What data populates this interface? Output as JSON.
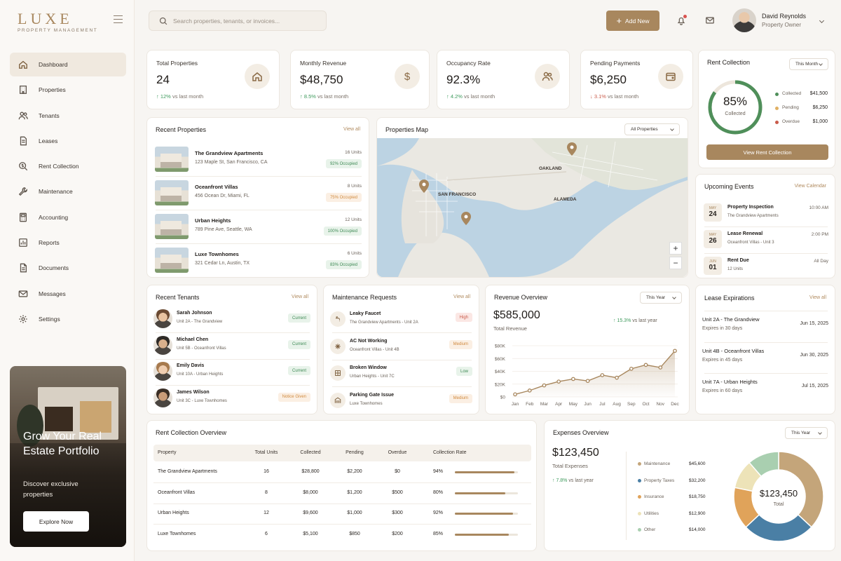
{
  "brand": {
    "name": "LUXE",
    "subtitle": "PROPERTY MANAGEMENT"
  },
  "nav": [
    {
      "label": "Dashboard",
      "icon": "home-icon",
      "active": true
    },
    {
      "label": "Properties",
      "icon": "building-icon"
    },
    {
      "label": "Tenants",
      "icon": "users-icon"
    },
    {
      "label": "Leases",
      "icon": "document-icon"
    },
    {
      "label": "Rent Collection",
      "icon": "dollar-search-icon"
    },
    {
      "label": "Maintenance",
      "icon": "wrench-icon"
    },
    {
      "label": "Accounting",
      "icon": "calculator-icon"
    },
    {
      "label": "Reports",
      "icon": "chart-icon"
    },
    {
      "label": "Documents",
      "icon": "file-icon"
    },
    {
      "label": "Messages",
      "icon": "mail-icon"
    },
    {
      "label": "Settings",
      "icon": "gear-icon"
    }
  ],
  "promo": {
    "title": "Grow Your Real Estate Portfolio",
    "subtitle": "Discover exclusive properties",
    "button": "Explore Now"
  },
  "header": {
    "search_placeholder": "Search properties, tenants, or invoices...",
    "add_button": "Add New",
    "user_name": "David Reynolds",
    "user_role": "Property Owner"
  },
  "stats": [
    {
      "label": "Total Properties",
      "value": "24",
      "change": "12%",
      "direction": "up",
      "suffix": "vs last month",
      "icon": "home-icon"
    },
    {
      "label": "Monthly Revenue",
      "value": "$48,750",
      "change": "8.5%",
      "direction": "up",
      "suffix": "vs last month",
      "icon": "dollar-icon"
    },
    {
      "label": "Occupancy Rate",
      "value": "92.3%",
      "change": "4.2%",
      "direction": "up",
      "suffix": "vs last month",
      "icon": "users-icon"
    },
    {
      "label": "Pending Payments",
      "value": "$6,250",
      "change": "3.1%",
      "direction": "down",
      "suffix": "vs last month",
      "icon": "wallet-icon"
    }
  ],
  "rent_collection": {
    "title": "Rent Collection",
    "period": "This Month",
    "percent": "85%",
    "percent_value": 0.85,
    "percent_label": "Collected",
    "items": [
      {
        "label": "Collected",
        "value": "$41,500",
        "color": "#4f8f5a"
      },
      {
        "label": "Pending",
        "value": "$6,250",
        "color": "#e0b063"
      },
      {
        "label": "Overdue",
        "value": "$1,000",
        "color": "#c95b4a"
      }
    ],
    "button": "View Rent Collection"
  },
  "recent_properties": {
    "title": "Recent Properties",
    "link": "View all",
    "items": [
      {
        "name": "The Grandview Apartments",
        "address": "123 Maple St, San Francisco, CA",
        "units": "16 Units",
        "occupancy": "92% Occupied",
        "status": "green"
      },
      {
        "name": "Oceanfront Villas",
        "address": "456 Ocean Dr, Miami, FL",
        "units": "8 Units",
        "occupancy": "75% Occupied",
        "status": "orange"
      },
      {
        "name": "Urban Heights",
        "address": "789 Pine Ave, Seattle, WA",
        "units": "12 Units",
        "occupancy": "100% Occupied",
        "status": "green"
      },
      {
        "name": "Luxe Townhomes",
        "address": "321 Cedar Ln, Austin, TX",
        "units": "6 Units",
        "occupancy": "83% Occupied",
        "status": "green"
      }
    ]
  },
  "map": {
    "title": "Properties Map",
    "filter": "All Properties",
    "labels": [
      "SAN FRANCISCO",
      "OAKLAND",
      "ALAMEDA"
    ],
    "zoom_in": "+",
    "zoom_out": "−"
  },
  "events": {
    "title": "Upcoming Events",
    "link": "View Calendar",
    "items": [
      {
        "month": "MAY",
        "day": "24",
        "title": "Property Inspection",
        "sub": "The Grandview Apartments",
        "time": "10:00 AM"
      },
      {
        "month": "MAY",
        "day": "26",
        "title": "Lease Renewal",
        "sub": "Oceanfront Villas - Unit 3",
        "time": "2:00 PM"
      },
      {
        "month": "JUN",
        "day": "01",
        "title": "Rent Due",
        "sub": "12 Units",
        "time": "All Day"
      }
    ]
  },
  "tenants": {
    "title": "Recent Tenants",
    "link": "View all",
    "items": [
      {
        "name": "Sarah Johnson",
        "unit": "Unit 2A - The Grandview",
        "status": "Current",
        "color": "green"
      },
      {
        "name": "Michael Chen",
        "unit": "Unit 5B - Oceanfront Villas",
        "status": "Current",
        "color": "green"
      },
      {
        "name": "Emily Davis",
        "unit": "Unit 10A - Urban Heights",
        "status": "Current",
        "color": "green"
      },
      {
        "name": "James Wilson",
        "unit": "Unit 3C - Luxe Townhomes",
        "status": "Notice Given",
        "color": "orange"
      }
    ]
  },
  "maintenance": {
    "title": "Maintenance Requests",
    "link": "View all",
    "items": [
      {
        "title": "Leaky Faucet",
        "sub": "The Grandview Apartments - Unit 2A",
        "priority": "High",
        "color": "red",
        "icon": "faucet-icon"
      },
      {
        "title": "AC Not Working",
        "sub": "Oceanfront Villas - Unit 4B",
        "priority": "Medium",
        "color": "orange",
        "icon": "ac-icon"
      },
      {
        "title": "Broken Window",
        "sub": "Urban Heights - Unit 7C",
        "priority": "Low",
        "color": "green",
        "icon": "window-icon"
      },
      {
        "title": "Parking Gate Issue",
        "sub": "Luxe Townhomes",
        "priority": "Medium",
        "color": "orange",
        "icon": "gate-icon"
      }
    ]
  },
  "revenue": {
    "title": "Revenue Overview",
    "period": "This Year",
    "total": "$585,000",
    "total_label": "Total Revenue",
    "change": "15.3%",
    "change_suffix": "vs last year"
  },
  "chart_data": {
    "type": "area",
    "categories": [
      "Jan",
      "Feb",
      "Mar",
      "Apr",
      "May",
      "Jun",
      "Jul",
      "Aug",
      "Sep",
      "Oct",
      "Nov",
      "Dec"
    ],
    "values": [
      4000,
      10000,
      18000,
      24000,
      28000,
      25000,
      34000,
      30000,
      44000,
      50000,
      46000,
      72000
    ],
    "ylim": [
      0,
      80000
    ],
    "ytick_labels": [
      "$0",
      "$20K",
      "$40K",
      "$60K",
      "$80K"
    ],
    "ytick_values": [
      0,
      20000,
      40000,
      60000,
      80000
    ],
    "color": "#a8875e"
  },
  "leases": {
    "title": "Lease Expirations",
    "link": "View all",
    "items": [
      {
        "unit": "Unit 2A - The Grandview",
        "expires": "Expires in 30 days",
        "date": "Jun 15, 2025"
      },
      {
        "unit": "Unit 4B - Oceanfront Villas",
        "expires": "Expires in 45 days",
        "date": "Jun 30, 2025"
      },
      {
        "unit": "Unit 7A - Urban Heights",
        "expires": "Expires in 60 days",
        "date": "Jul 15, 2025"
      }
    ]
  },
  "rent_overview": {
    "title": "Rent Collection Overview",
    "headers": [
      "Property",
      "Total Units",
      "Collected",
      "Pending",
      "Overdue",
      "Collection Rate"
    ],
    "rows": [
      {
        "property": "The Grandview Apartments",
        "units": "16",
        "collected": "$28,800",
        "pending": "$2,200",
        "overdue": "$0",
        "rate": "94%",
        "rate_value": 0.94
      },
      {
        "property": "Oceanfront Villas",
        "units": "8",
        "collected": "$8,000",
        "pending": "$1,200",
        "overdue": "$500",
        "rate": "80%",
        "rate_value": 0.8
      },
      {
        "property": "Urban Heights",
        "units": "12",
        "collected": "$9,600",
        "pending": "$1,000",
        "overdue": "$300",
        "rate": "92%",
        "rate_value": 0.92
      },
      {
        "property": "Luxe Townhomes",
        "units": "6",
        "collected": "$5,100",
        "pending": "$850",
        "overdue": "$200",
        "rate": "85%",
        "rate_value": 0.85
      }
    ]
  },
  "expenses": {
    "title": "Expenses Overview",
    "period": "This Year",
    "total": "$123,450",
    "total_label": "Total Expenses",
    "change": "7.8%",
    "change_suffix": "vs last year",
    "center_value": "$123,450",
    "center_label": "Total",
    "items": [
      {
        "label": "Maintenance",
        "value": "$45,600",
        "amount": 45600,
        "color": "#c4a57a"
      },
      {
        "label": "Property Taxes",
        "value": "$32,200",
        "amount": 32200,
        "color": "#4a7fa5"
      },
      {
        "label": "Insurance",
        "value": "$18,750",
        "amount": 18750,
        "color": "#e0a35a"
      },
      {
        "label": "Utilities",
        "value": "$12,900",
        "amount": 12900,
        "color": "#ede3b8"
      },
      {
        "label": "Other",
        "value": "$14,000",
        "amount": 14000,
        "color": "#a9cfb0"
      }
    ]
  }
}
